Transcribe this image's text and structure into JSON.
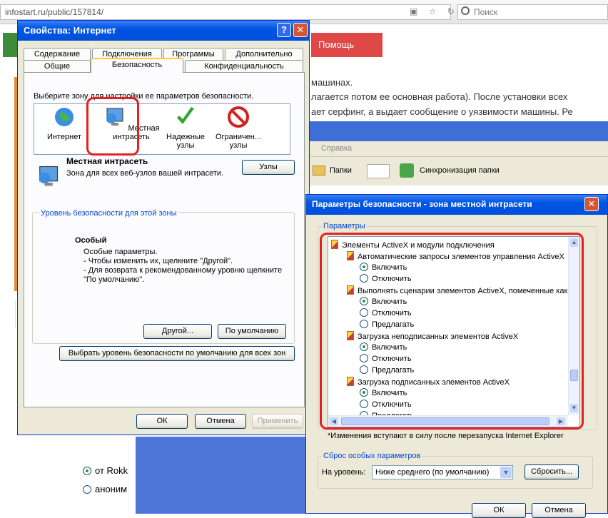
{
  "browser": {
    "url": "infostart.ru/public/157814/",
    "search_placeholder": "Поиск"
  },
  "page": {
    "help_button": "Помощь",
    "text_lines": [
      "машинах.",
      "лагается потом ее основная работа). После установки всех",
      "ает серфинг, а выдает сообщение о уязвимости машины. Ре"
    ],
    "radio_options": [
      "от Rokk",
      "аноним"
    ]
  },
  "explorer": {
    "menu_help": "Справка",
    "folders_button": "Папки",
    "sync_button": "Синхронизация папки"
  },
  "dialog_internet": {
    "title": "Свойства: Интернет",
    "tabs_row1": [
      "Содержание",
      "Подключения",
      "Программы",
      "Дополнительно"
    ],
    "tabs_row2": [
      "Общие",
      "Безопасность",
      "Конфиденциальность"
    ],
    "active_tab": "Безопасность",
    "zone_prompt": "Выберите зону для настройки ее параметров безопасности.",
    "zones": [
      {
        "label": "Интернет",
        "icon": "globe-icon"
      },
      {
        "label": "Местная интрасеть",
        "icon": "intranet-icon"
      },
      {
        "label": "Надежные узлы",
        "icon": "check-icon"
      },
      {
        "label": "Ограничен... узлы",
        "icon": "restricted-icon"
      }
    ],
    "selected_zone_title": "Местная интрасеть",
    "selected_zone_desc": "Зона для всех веб-узлов вашей интрасети.",
    "sites_button": "Узлы",
    "level_group_title": "Уровень безопасности для этой зоны",
    "level_name": "Особый",
    "level_desc": [
      "Особые параметры.",
      "- Чтобы изменить их, щелкните \"Другой\".",
      "- Для возврата к рекомендованному уровню щелкните",
      "\"По умолчанию\"."
    ],
    "other_button": "Другой...",
    "default_button": "По умолчанию",
    "all_default_button": "Выбрать уровень безопасности по умолчанию для всех зон",
    "ok_button": "ОК",
    "cancel_button": "Отмена",
    "apply_button": "Применить"
  },
  "dialog_settings": {
    "title": "Параметры безопасности - зона местной интрасети",
    "params_label": "Параметры",
    "tree": [
      {
        "type": "category",
        "label": "Элементы ActiveX и модули подключения"
      },
      {
        "type": "setting",
        "label": "Автоматические запросы элементов управления ActiveX"
      },
      {
        "type": "option",
        "label": "Включить",
        "checked": true
      },
      {
        "type": "option",
        "label": "Отключить",
        "checked": false
      },
      {
        "type": "setting",
        "label": "Выполнять сценарии элементов ActiveX, помеченные как"
      },
      {
        "type": "option",
        "label": "Включить",
        "checked": true
      },
      {
        "type": "option",
        "label": "Отключить",
        "checked": false
      },
      {
        "type": "option",
        "label": "Предлагать",
        "checked": false
      },
      {
        "type": "setting",
        "label": "Загрузка неподписанных элементов ActiveX"
      },
      {
        "type": "option",
        "label": "Включить",
        "checked": true
      },
      {
        "type": "option",
        "label": "Отключить",
        "checked": false
      },
      {
        "type": "option",
        "label": "Предлагать",
        "checked": false
      },
      {
        "type": "setting",
        "label": "Загрузка подписанных элементов ActiveX"
      },
      {
        "type": "option",
        "label": "Включить",
        "checked": true
      },
      {
        "type": "option",
        "label": "Отключить",
        "checked": false
      },
      {
        "type": "option",
        "label": "Предлагать",
        "checked": false
      }
    ],
    "note": "*Изменения вступают в силу после перезапуска Internet Explorer",
    "reset_group_title": "Сброс особых параметров",
    "reset_to_label": "На уровень:",
    "reset_level_value": "Ниже среднего (по умолчанию)",
    "reset_button": "Сбросить...",
    "ok_button": "ОК",
    "cancel_button": "Отмена"
  },
  "colors": {
    "title_blue": "#0054e3",
    "dialog_face": "#ece9d8",
    "annotation_red": "#e42020",
    "help_red": "#e04848"
  }
}
